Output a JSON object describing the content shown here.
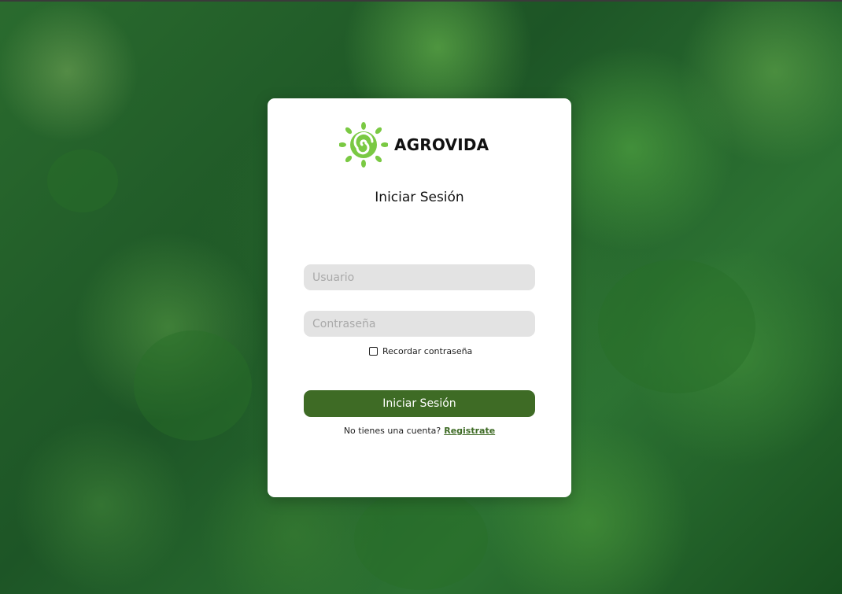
{
  "brand": {
    "name": "AGROVIDA",
    "logo_icon": "spiral-sun-icon",
    "logo_color": "#7ac943"
  },
  "background": {
    "description_icon": "forest-canopy-background"
  },
  "login": {
    "title": "Iniciar Sesión",
    "username_placeholder": "Usuario",
    "password_placeholder": "Contraseña",
    "remember_label": "Recordar contraseña",
    "submit_label": "Iniciar Sesión",
    "signup_prompt": "No tienes una cuenta?",
    "signup_link": "Registrate"
  },
  "colors": {
    "accent": "#3e6b25",
    "field_bg": "#e3e3e3",
    "card_bg": "#ffffff"
  }
}
